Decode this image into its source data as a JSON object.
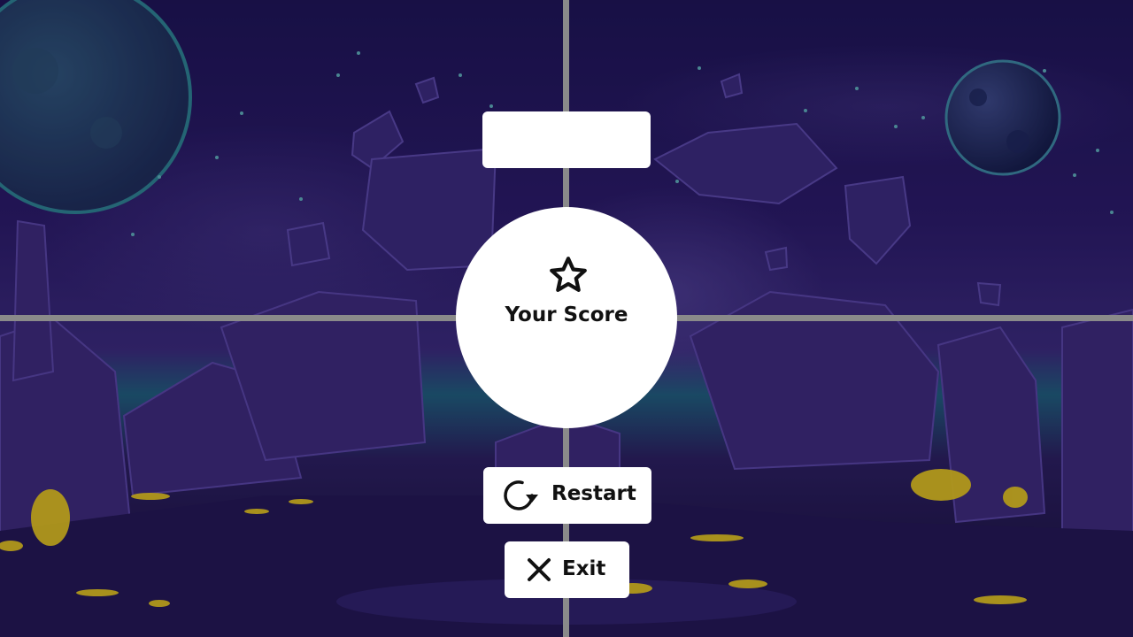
{
  "score_panel": {
    "title_value": "",
    "label": "Your Score",
    "icon": "star-icon"
  },
  "buttons": {
    "restart_label": "Restart",
    "restart_icon": "restart-icon",
    "exit_label": "Exit",
    "exit_icon": "close-icon"
  },
  "background": {
    "theme": "alien-planet-night",
    "sky_color": "#2a1a66",
    "rock_color": "#4a3486",
    "glow_color": "#e8c81a",
    "grid_line_color": "#8a8a8a"
  }
}
